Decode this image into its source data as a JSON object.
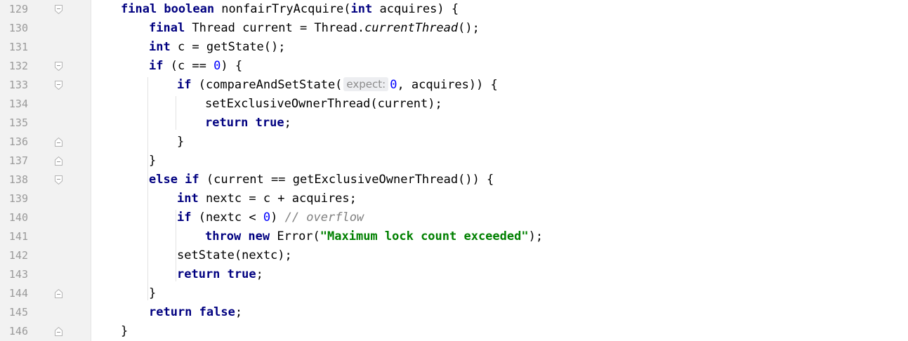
{
  "lines": [
    {
      "n": "129",
      "fold": "start",
      "indent": 1,
      "tokens": [
        [
          "kw",
          "final boolean "
        ],
        [
          "p",
          "nonfairTryAcquire("
        ],
        [
          "kw",
          "int "
        ],
        [
          "p",
          "acquires) {"
        ]
      ]
    },
    {
      "n": "130",
      "fold": "",
      "indent": 2,
      "tokens": [
        [
          "kw",
          "final "
        ],
        [
          "p",
          "Thread current = Thread."
        ],
        [
          "it",
          "currentThread"
        ],
        [
          "p",
          "();"
        ]
      ]
    },
    {
      "n": "131",
      "fold": "",
      "indent": 2,
      "tokens": [
        [
          "kw",
          "int "
        ],
        [
          "p",
          "c = getState();"
        ]
      ]
    },
    {
      "n": "132",
      "fold": "start",
      "indent": 2,
      "tokens": [
        [
          "kw",
          "if "
        ],
        [
          "p",
          "(c == "
        ],
        [
          "num",
          "0"
        ],
        [
          "p",
          ") {"
        ]
      ]
    },
    {
      "n": "133",
      "fold": "start",
      "indent": 3,
      "tokens": [
        [
          "kw",
          "if "
        ],
        [
          "p",
          "(compareAndSetState("
        ],
        [
          "hint",
          "expect:"
        ],
        [
          "num",
          "0"
        ],
        [
          "p",
          ", acquires)) {"
        ]
      ]
    },
    {
      "n": "134",
      "fold": "",
      "indent": 4,
      "tokens": [
        [
          "p",
          "setExclusiveOwnerThread(current);"
        ]
      ]
    },
    {
      "n": "135",
      "fold": "",
      "indent": 4,
      "tokens": [
        [
          "kw",
          "return true"
        ],
        [
          "p",
          ";"
        ]
      ]
    },
    {
      "n": "136",
      "fold": "end",
      "indent": 3,
      "tokens": [
        [
          "p",
          "}"
        ]
      ]
    },
    {
      "n": "137",
      "fold": "end",
      "indent": 2,
      "tokens": [
        [
          "p",
          "}"
        ]
      ]
    },
    {
      "n": "138",
      "fold": "start",
      "indent": 2,
      "tokens": [
        [
          "kw",
          "else if "
        ],
        [
          "p",
          "(current == getExclusiveOwnerThread()) {"
        ]
      ]
    },
    {
      "n": "139",
      "fold": "",
      "indent": 3,
      "tokens": [
        [
          "kw",
          "int "
        ],
        [
          "p",
          "nextc = c + acquires;"
        ]
      ]
    },
    {
      "n": "140",
      "fold": "",
      "indent": 3,
      "tokens": [
        [
          "kw",
          "if "
        ],
        [
          "p",
          "(nextc < "
        ],
        [
          "num",
          "0"
        ],
        [
          "p",
          ") "
        ],
        [
          "cm",
          "// overflow"
        ]
      ]
    },
    {
      "n": "141",
      "fold": "",
      "indent": 4,
      "tokens": [
        [
          "kw",
          "throw new "
        ],
        [
          "p",
          "Error("
        ],
        [
          "str",
          "\"Maximum lock count exceeded\""
        ],
        [
          "p",
          ");"
        ]
      ]
    },
    {
      "n": "142",
      "fold": "",
      "indent": 3,
      "tokens": [
        [
          "p",
          "setState(nextc);"
        ]
      ]
    },
    {
      "n": "143",
      "fold": "",
      "indent": 3,
      "tokens": [
        [
          "kw",
          "return true"
        ],
        [
          "p",
          ";"
        ]
      ]
    },
    {
      "n": "144",
      "fold": "end",
      "indent": 2,
      "tokens": [
        [
          "p",
          "}"
        ]
      ]
    },
    {
      "n": "145",
      "fold": "",
      "indent": 2,
      "tokens": [
        [
          "kw",
          "return false"
        ],
        [
          "p",
          ";"
        ]
      ]
    },
    {
      "n": "146",
      "fold": "end",
      "indent": 1,
      "tokens": [
        [
          "p",
          "}"
        ]
      ]
    }
  ],
  "colors": {
    "keyword": "#000080",
    "number": "#0000ff",
    "string": "#008000",
    "comment": "#808080",
    "hint_bg": "#edeef1",
    "gutter_bg": "#f2f2f2",
    "line_number": "#9a9a9a"
  },
  "icons": {
    "fold_start": "fold-open-icon",
    "fold_end": "fold-close-icon"
  }
}
